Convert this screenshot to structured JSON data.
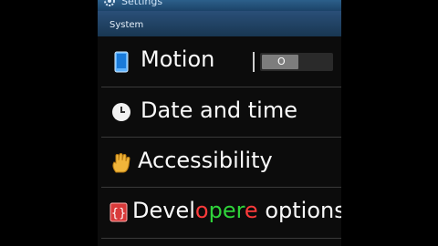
{
  "app": {
    "title": "Settings"
  },
  "section": {
    "label": "System"
  },
  "items": [
    {
      "label": "Motion",
      "icon": "motion-icon",
      "toggle": {
        "state_label": "O",
        "on": false
      }
    },
    {
      "label": "Date and time",
      "icon": "clock-icon"
    },
    {
      "label": "Accessibility",
      "icon": "hand-icon"
    },
    {
      "label_parts": [
        "Devel",
        "o",
        "per",
        "e",
        " options"
      ],
      "icon": "developer-icon"
    }
  ],
  "colors": {
    "accent": "#2a4f78",
    "text": "#fafafa",
    "overlay_green": "#2fd33a",
    "overlay_red": "#ff3b3b"
  }
}
